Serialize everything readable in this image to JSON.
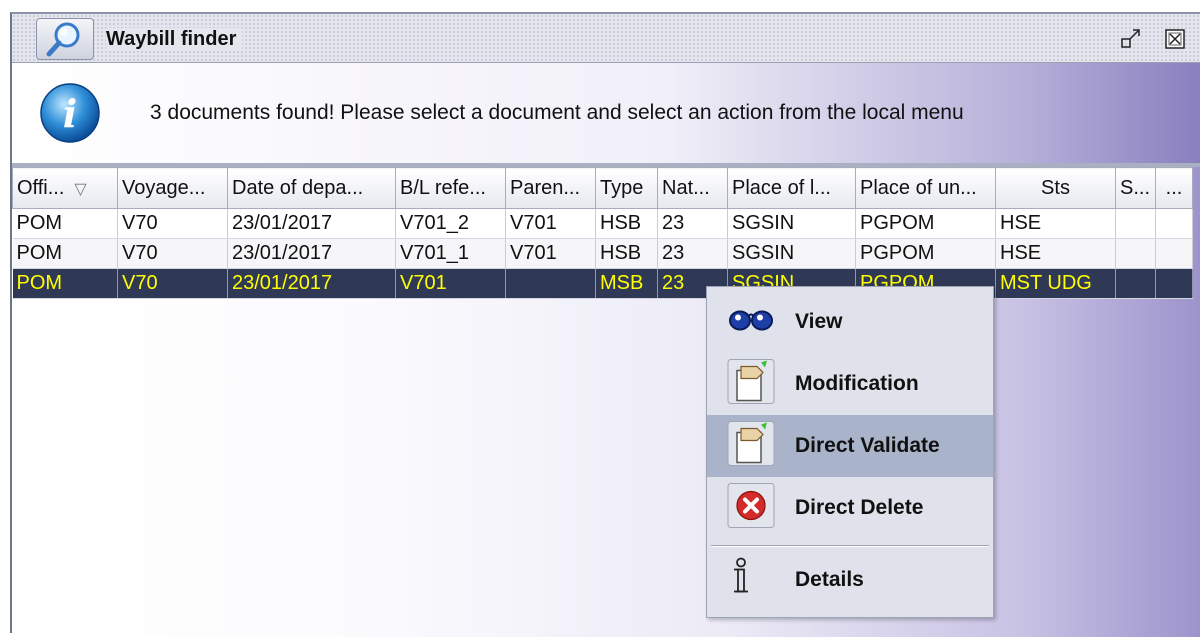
{
  "window": {
    "title": "Waybill finder"
  },
  "titlebar_buttons": [
    {
      "name": "restore",
      "glyph": "⇱"
    },
    {
      "name": "close",
      "glyph": "⊠"
    }
  ],
  "info": {
    "message": "3 documents found! Please select a document and select an action from the local menu"
  },
  "table": {
    "columns": [
      "Offi...",
      "Voyage...",
      "Date of depa...",
      "B/L refe...",
      "Paren...",
      "Type",
      "Nat...",
      "Place of l...",
      "Place of un...",
      "Sts",
      "S...",
      "..."
    ],
    "sort_indicator": "▽",
    "rows": [
      [
        "POM",
        "V70",
        "23/01/2017",
        "V701_2",
        "V701",
        "HSB",
        "23",
        "SGSIN",
        "PGPOM",
        "HSE",
        "",
        ""
      ],
      [
        "POM",
        "V70",
        "23/01/2017",
        "V701_1",
        "V701",
        "HSB",
        "23",
        "SGSIN",
        "PGPOM",
        "HSE",
        "",
        ""
      ],
      [
        "POM",
        "V70",
        "23/01/2017",
        "V701",
        "",
        "MSB",
        "23",
        "SGSIN",
        "PGPOM",
        "MST UDG",
        "",
        ""
      ]
    ],
    "selected_row": 2
  },
  "context_menu": {
    "items": [
      {
        "label": "View",
        "icon": "glasses-icon"
      },
      {
        "label": "Modification",
        "icon": "document-hand-icon"
      },
      {
        "label": "Direct Validate",
        "icon": "document-hand-icon",
        "highlighted": true
      },
      {
        "label": "Direct Delete",
        "icon": "red-x-icon"
      },
      {
        "label": "Details",
        "icon": "info-i-icon"
      }
    ]
  }
}
